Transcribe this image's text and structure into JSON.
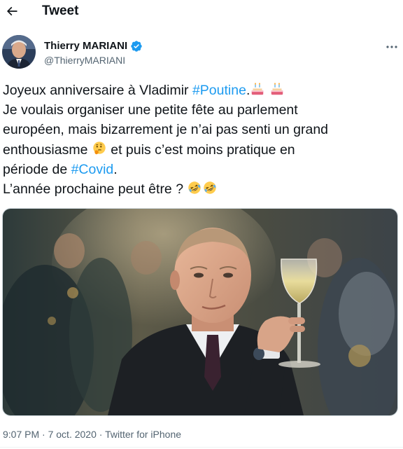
{
  "header": {
    "title": "Tweet",
    "back_icon": "arrow-left-icon"
  },
  "author": {
    "display_name": "Thierry MARIANI",
    "handle": "@ThierryMARIANI",
    "verified_icon": "verified-badge-icon",
    "verified_color": "#1d9bf0",
    "more_icon": "more-horizontal-icon"
  },
  "tweet": {
    "line1_a": "Joyeux anniversaire à Vladimir ",
    "line1_hashtag": "#Poutine",
    "line1_b": ".",
    "line2": "Je voulais organiser une petite fête au parlement",
    "line3": "européen, mais bizarrement je n’ai pas senti un grand",
    "line4_a": "enthousiasme ",
    "line4_b": " et puis c’est moins pratique en",
    "line5_a": "période de ",
    "line5_hashtag": "#Covid",
    "line5_b": ".",
    "line6": "L’année prochaine peut être ? ",
    "emojis": [
      "birthday-cake-icon",
      "birthday-cake-icon",
      "thinking-face-icon",
      "rolling-laughing-icon",
      "rolling-laughing-icon"
    ],
    "hashtag_color": "#1d9bf0"
  },
  "meta": {
    "time": "9:07 PM",
    "date": "7 oct. 2020",
    "source": "Twitter for iPhone",
    "separator": "·"
  }
}
